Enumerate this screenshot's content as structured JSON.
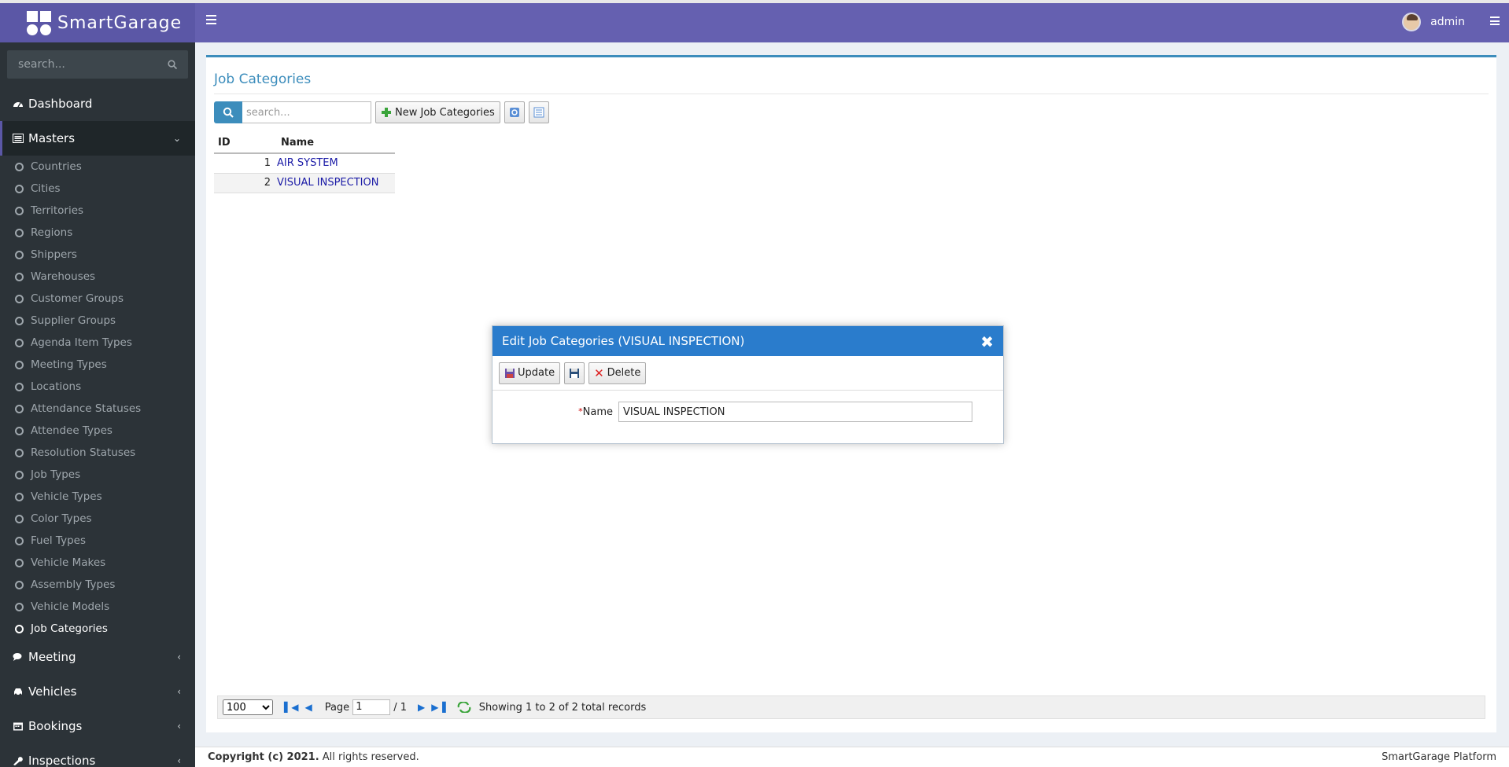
{
  "app": {
    "name": "SmartGarage",
    "user": "admin"
  },
  "sidebar": {
    "search_placeholder": "search...",
    "dashboard": "Dashboard",
    "masters": "Masters",
    "master_items": [
      "Countries",
      "Cities",
      "Territories",
      "Regions",
      "Shippers",
      "Warehouses",
      "Customer Groups",
      "Supplier Groups",
      "Agenda Item Types",
      "Meeting Types",
      "Locations",
      "Attendance Statuses",
      "Attendee Types",
      "Resolution Statuses",
      "Job Types",
      "Vehicle Types",
      "Color Types",
      "Fuel Types",
      "Vehicle Makes",
      "Assembly Types",
      "Vehicle Models",
      "Job Categories"
    ],
    "meeting": "Meeting",
    "vehicles": "Vehicles",
    "bookings": "Bookings",
    "inspections": "Inspections"
  },
  "page": {
    "title": "Job Categories",
    "search_placeholder": "search...",
    "new_button": "New Job Categories",
    "columns": [
      "ID",
      "Name"
    ],
    "rows": [
      {
        "id": "1",
        "name": "AIR SYSTEM"
      },
      {
        "id": "2",
        "name": "VISUAL INSPECTION"
      }
    ]
  },
  "pager": {
    "page_size": "100",
    "page_label": "Page",
    "page_value": "1",
    "page_total": "/ 1",
    "status": "Showing 1 to 2 of 2 total records"
  },
  "dialog": {
    "title": "Edit Job Categories (VISUAL INSPECTION)",
    "update": "Update",
    "delete": "Delete",
    "field_label": "Name",
    "required_mark": "*",
    "field_value": "VISUAL INSPECTION"
  },
  "footer": {
    "copyright": "Copyright (c) 2021.",
    "rights": " All rights reserved.",
    "platform": "SmartGarage Platform"
  },
  "colors": {
    "header": "#6560b0",
    "sidebar": "#2c3338",
    "accent": "#3c8dbc",
    "dialog_header": "#2a7ccc"
  }
}
